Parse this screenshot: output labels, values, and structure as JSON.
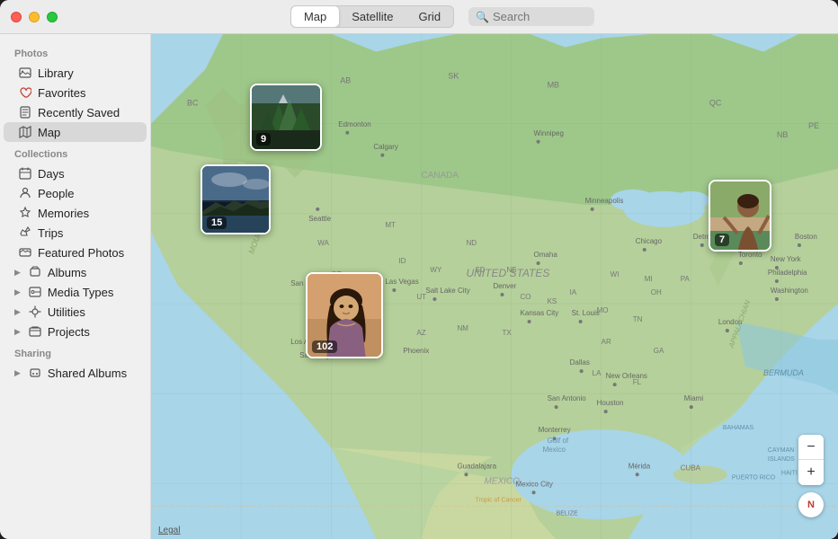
{
  "window": {
    "title": "Photos"
  },
  "titlebar": {
    "traffic_lights": [
      "red",
      "yellow",
      "green"
    ]
  },
  "view_tabs": {
    "tabs": [
      {
        "label": "Map",
        "active": true
      },
      {
        "label": "Satellite",
        "active": false
      },
      {
        "label": "Grid",
        "active": false
      }
    ],
    "search_placeholder": "Search"
  },
  "sidebar": {
    "photos_section": "Photos",
    "photos_items": [
      {
        "label": "Library",
        "icon": "📷"
      },
      {
        "label": "Favorites",
        "icon": "♡"
      },
      {
        "label": "Recently Saved",
        "icon": "↑"
      },
      {
        "label": "Map",
        "icon": "🗺",
        "active": true
      }
    ],
    "collections_section": "Collections",
    "collections_items": [
      {
        "label": "Days",
        "icon": "📅"
      },
      {
        "label": "People",
        "icon": "👤"
      },
      {
        "label": "Memories",
        "icon": "✨"
      },
      {
        "label": "Trips",
        "icon": "✈"
      },
      {
        "label": "Featured Photos",
        "icon": "⭐"
      }
    ],
    "group_items": [
      {
        "label": "Albums"
      },
      {
        "label": "Media Types"
      },
      {
        "label": "Utilities"
      },
      {
        "label": "Projects"
      }
    ],
    "sharing_section": "Sharing",
    "shared_items": [
      {
        "label": "Shared Albums"
      }
    ]
  },
  "map": {
    "clusters": [
      {
        "id": "cluster1",
        "count": "9",
        "top": "60",
        "left": "120",
        "width": "80",
        "height": "75",
        "type": "forest"
      },
      {
        "id": "cluster2",
        "count": "15",
        "top": "150",
        "left": "65",
        "width": "78",
        "height": "78",
        "type": "coast"
      },
      {
        "id": "cluster3",
        "count": "7",
        "top": "168",
        "left": "620",
        "width": "70",
        "height": "80",
        "type": "portrait"
      },
      {
        "id": "cluster4",
        "count": "102",
        "top": "270",
        "left": "175",
        "width": "85",
        "height": "95",
        "type": "girl"
      }
    ],
    "legal_text": "Legal"
  },
  "map_controls": {
    "zoom_in": "+",
    "zoom_out": "−",
    "compass": "N"
  }
}
